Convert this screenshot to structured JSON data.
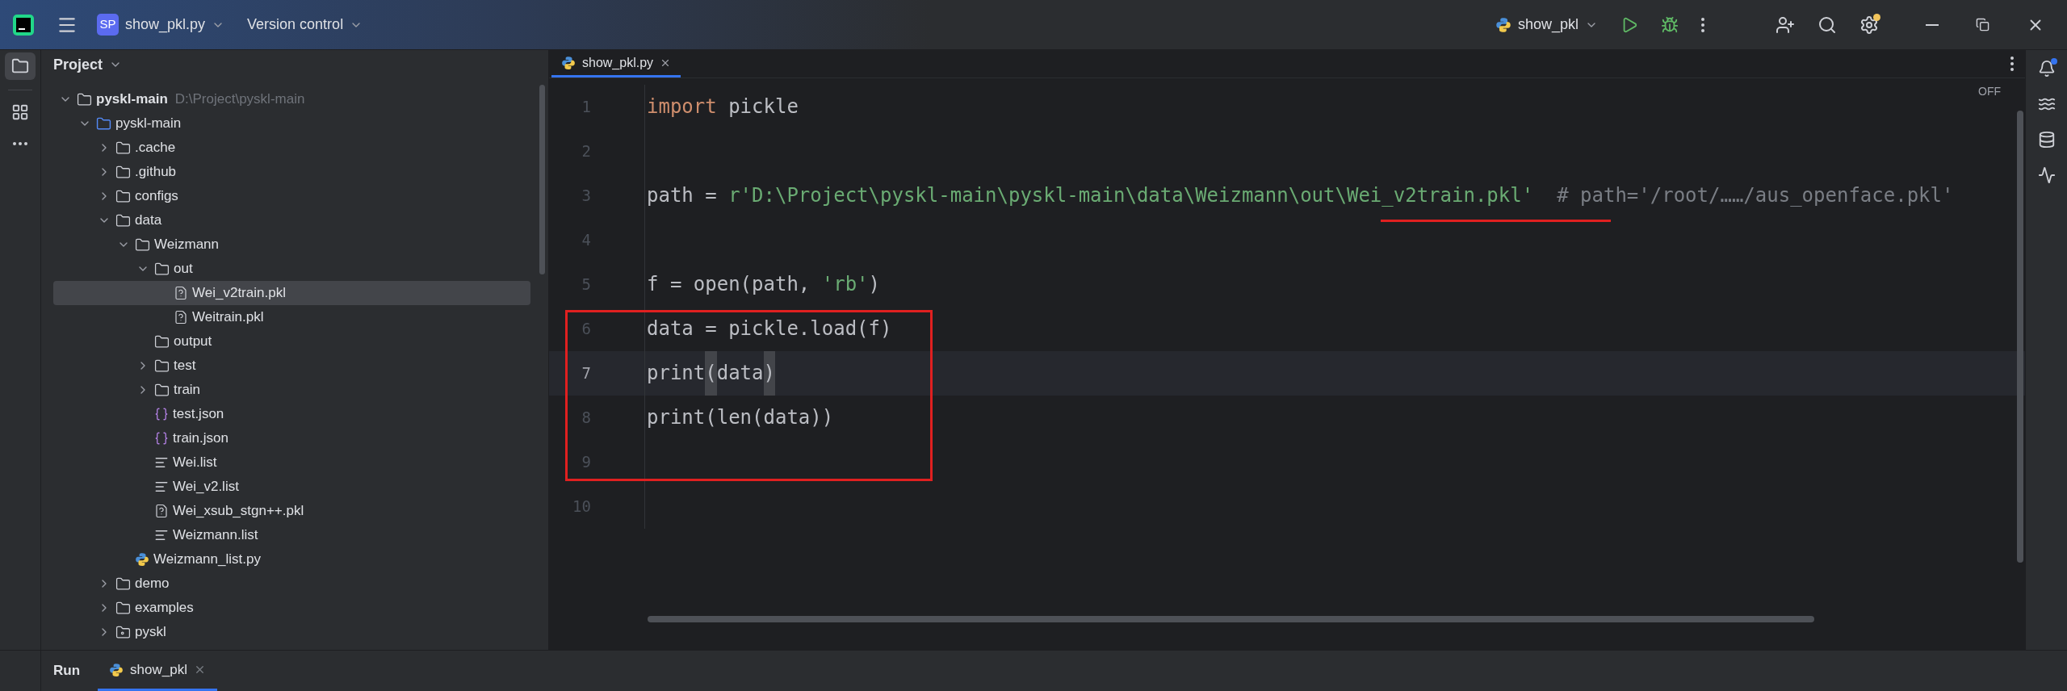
{
  "title_bar": {
    "project_badge": "SP",
    "project": "show_pkl.py",
    "vcs": "Version control",
    "run_config": "show_pkl",
    "settings_badge": true
  },
  "project_panel": {
    "title": "Project",
    "tree": [
      {
        "name": "pyskl-main",
        "hint": "D:\\Project\\pyskl-main",
        "kind": "folder",
        "bold": true,
        "expanded": true,
        "selected": false,
        "children": [
          {
            "name": "pyskl-main",
            "kind": "source-folder",
            "expanded": true,
            "selected": false,
            "children": [
              {
                "name": ".cache",
                "kind": "folder",
                "expanded": false,
                "selected": false
              },
              {
                "name": ".github",
                "kind": "folder",
                "expanded": false,
                "selected": false
              },
              {
                "name": "configs",
                "kind": "folder",
                "expanded": false,
                "selected": false
              },
              {
                "name": "data",
                "kind": "folder",
                "expanded": true,
                "selected": false,
                "children": [
                  {
                    "name": "Weizmann",
                    "kind": "folder",
                    "expanded": true,
                    "selected": false,
                    "children": [
                      {
                        "name": "out",
                        "kind": "folder",
                        "expanded": true,
                        "selected": false,
                        "children": [
                          {
                            "name": "Wei_v2train.pkl",
                            "kind": "unknown-file",
                            "selected": true
                          },
                          {
                            "name": "Weitrain.pkl",
                            "kind": "unknown-file",
                            "selected": false
                          }
                        ]
                      },
                      {
                        "name": "output",
                        "kind": "folder",
                        "selected": false
                      },
                      {
                        "name": "test",
                        "kind": "folder",
                        "expanded": false,
                        "selected": false
                      },
                      {
                        "name": "train",
                        "kind": "folder",
                        "expanded": false,
                        "selected": false
                      },
                      {
                        "name": "test.json",
                        "kind": "json",
                        "selected": false
                      },
                      {
                        "name": "train.json",
                        "kind": "json",
                        "selected": false
                      },
                      {
                        "name": "Wei.list",
                        "kind": "text",
                        "selected": false
                      },
                      {
                        "name": "Wei_v2.list",
                        "kind": "text",
                        "selected": false
                      },
                      {
                        "name": "Wei_xsub_stgn++.pkl",
                        "kind": "unknown-file",
                        "selected": false
                      },
                      {
                        "name": "Weizmann.list",
                        "kind": "text",
                        "selected": false
                      }
                    ]
                  },
                  {
                    "name": "Weizmann_list.py",
                    "kind": "python",
                    "selected": false
                  }
                ]
              },
              {
                "name": "demo",
                "kind": "folder",
                "expanded": false,
                "selected": false
              },
              {
                "name": "examples",
                "kind": "folder",
                "expanded": false,
                "selected": false
              },
              {
                "name": "pyskl",
                "kind": "package",
                "expanded": false,
                "selected": false
              }
            ]
          }
        ]
      }
    ]
  },
  "editor": {
    "tabs": [
      {
        "label": "show_pkl.py",
        "selected": true
      }
    ],
    "inspection": "OFF",
    "lines": [
      {
        "number": "1",
        "current": false,
        "tokens": [
          {
            "kind": "keyword",
            "text": "import"
          },
          {
            "kind": "plain",
            "text": " pickle"
          }
        ]
      },
      {
        "number": "2",
        "current": false
      },
      {
        "number": "3",
        "current": false,
        "tokens": [
          {
            "kind": "plain",
            "text": "path = "
          },
          {
            "kind": "string",
            "text": "r'D:\\Project\\pyskl-main\\pyskl-main\\data\\Weizmann\\out\\Wei_v2train.pkl'"
          },
          {
            "kind": "comment",
            "text": "# path='/root/……/aus_openface.pkl'"
          }
        ]
      },
      {
        "number": "4",
        "current": false
      },
      {
        "number": "5",
        "current": false,
        "tokens": [
          {
            "kind": "plain",
            "text": "f = open(path, "
          },
          {
            "kind": "string",
            "text": "'rb'"
          },
          {
            "kind": "plain",
            "text": ")"
          }
        ]
      },
      {
        "number": "6",
        "current": false,
        "tokens": [
          {
            "kind": "plain",
            "text": "data = pickle.load(f)"
          }
        ]
      },
      {
        "number": "7",
        "current": true,
        "tokens": [
          {
            "kind": "plain",
            "text": "print"
          },
          {
            "kind": "brace",
            "text": "("
          },
          {
            "kind": "plain",
            "text": "data"
          },
          {
            "kind": "brace",
            "text": ")"
          }
        ]
      },
      {
        "number": "8",
        "current": false,
        "tokens": [
          {
            "kind": "plain",
            "text": "print(len(data))"
          }
        ]
      },
      {
        "number": "9",
        "current": false
      },
      {
        "number": "10",
        "current": false
      }
    ]
  },
  "bottom_panel": {
    "title": "Run",
    "tabs": [
      {
        "label": "show_pkl",
        "selected": true
      }
    ]
  }
}
